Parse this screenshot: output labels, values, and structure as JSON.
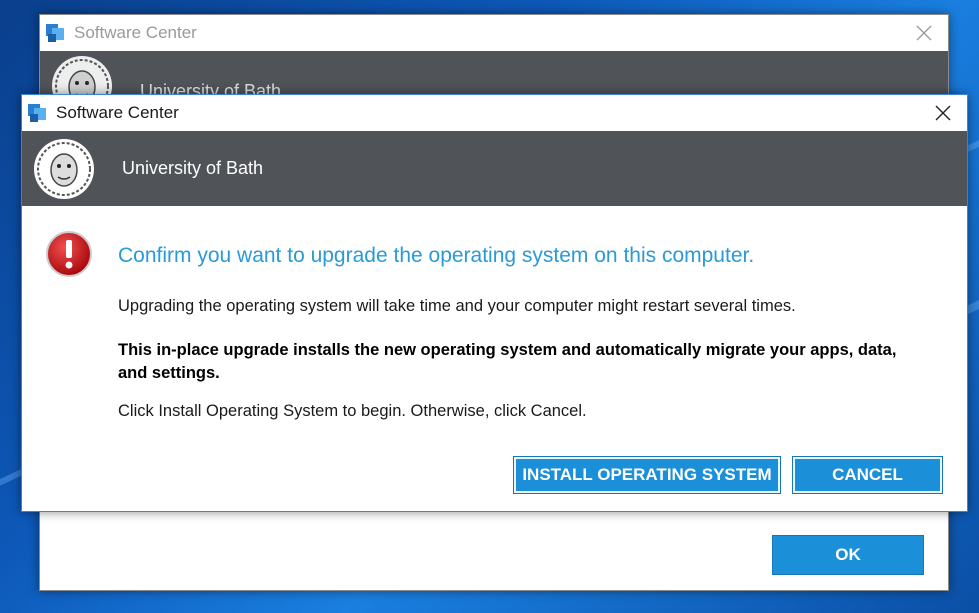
{
  "back_window": {
    "title": "Software Center",
    "org_name": "University of Bath",
    "ok_label": "OK"
  },
  "dialog": {
    "title": "Software Center",
    "org_name": "University of Bath",
    "heading": "Confirm you want to upgrade the operating system on this computer.",
    "paragraph1": "Upgrading the operating system will take time and your computer might restart several times.",
    "paragraph2": "This in-place upgrade installs the new operating system and automatically migrate your apps, data, and settings.",
    "paragraph3": "Click Install Operating System to begin. Otherwise, click Cancel.",
    "install_label": "INSTALL OPERATING SYSTEM",
    "cancel_label": "CANCEL"
  },
  "icons": {
    "app": "software-center-icon",
    "close": "close-icon",
    "logo": "university-logo",
    "error": "error-icon"
  },
  "colors": {
    "accent": "#1b8fd8",
    "heading": "#2a9ad6",
    "banner": "#505459",
    "error": "#c8191c"
  }
}
